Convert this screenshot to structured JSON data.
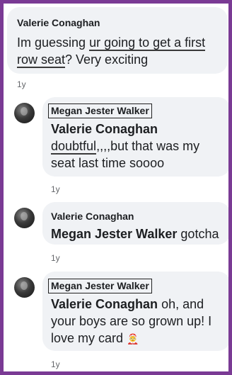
{
  "comments": [
    {
      "author": "Valerie Conaghan",
      "text_plain_1": "Im guessing ",
      "text_ul_1": "ur going to get a first",
      "text_ul_2": "row seat",
      "text_plain_2": "? Very exciting",
      "timestamp": "1y"
    },
    {
      "author": "Megan Jester Walker",
      "mention": "Valerie Conaghan",
      "text_ul": "doubtful",
      "text_rest_1": ",,,,but that was my",
      "text_rest_2": "seat last time soooo",
      "timestamp": "1y"
    },
    {
      "author": "Valerie Conaghan",
      "mention": "Megan Jester Walker",
      "text": " gotcha",
      "timestamp": "1y"
    },
    {
      "author": "Megan Jester Walker",
      "mention": "Valerie Conaghan",
      "text_1": " oh, and",
      "text_2": "your boys are so grown up! I",
      "text_3": "love my card",
      "emoji": "🤶",
      "timestamp": "1y"
    }
  ],
  "colors": {
    "frame": "#7a3a94",
    "bubble": "#f0f2f5",
    "timestamp": "#65676b"
  }
}
